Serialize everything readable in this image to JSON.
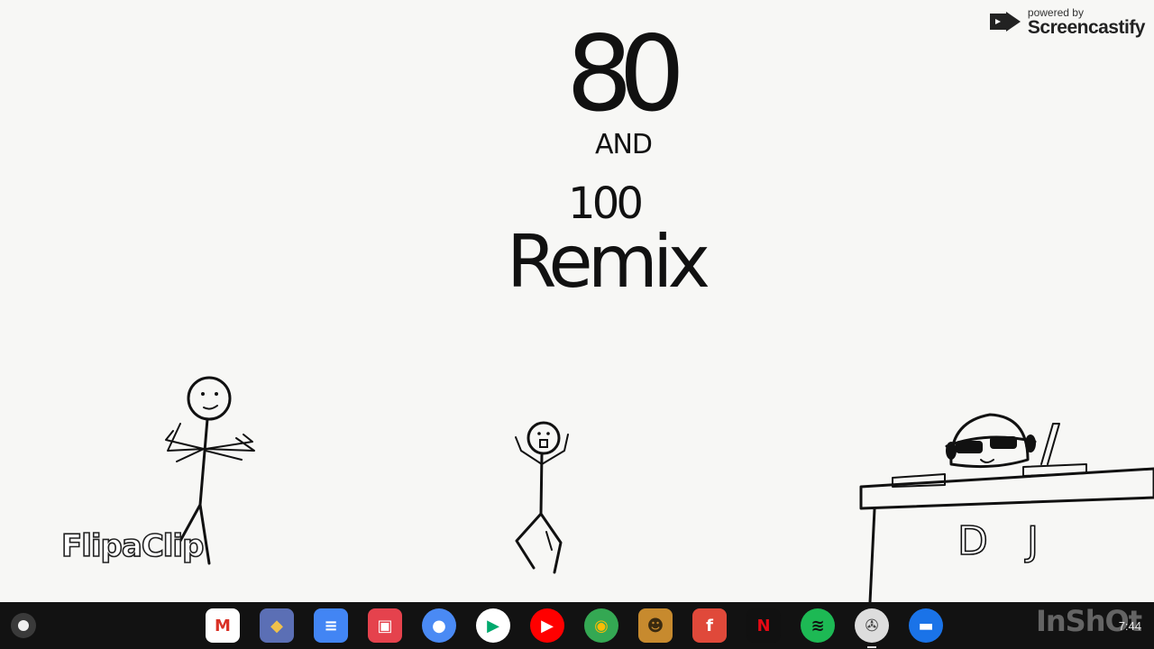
{
  "overlay": {
    "powered_by": "powered by",
    "brand": "Screencastify",
    "flipaclip": "FlipaClip",
    "inshot": "InShOt"
  },
  "drawing": {
    "title_line1": "80",
    "title_line2": "AND",
    "title_line3": "100",
    "title_line4": "Remix",
    "dj_label": "DJ"
  },
  "shelf": {
    "apps": [
      {
        "name": "gmail-icon",
        "color": "#ffffff",
        "glyph": "M",
        "fg": "#d93025"
      },
      {
        "name": "game-icon",
        "color": "#5b6fb5",
        "glyph": "◆",
        "fg": "#f0c14b"
      },
      {
        "name": "docs-icon",
        "color": "#4285f4",
        "glyph": "≡",
        "fg": "#ffffff"
      },
      {
        "name": "inshot-app-icon",
        "color": "#e5424d",
        "glyph": "▣",
        "fg": "#ffffff"
      },
      {
        "name": "palette-icon",
        "color": "#4a8af4",
        "glyph": "●",
        "fg": "#ffffff"
      },
      {
        "name": "play-store-icon",
        "color": "#ffffff",
        "glyph": "▶",
        "fg": "#00a96d"
      },
      {
        "name": "youtube-icon",
        "color": "#ff0000",
        "glyph": "▶",
        "fg": "#ffffff"
      },
      {
        "name": "chrome-icon",
        "color": "#34a853",
        "glyph": "◉",
        "fg": "#fbbc05"
      },
      {
        "name": "cartoon-game-icon",
        "color": "#c78a2e",
        "glyph": "☻",
        "fg": "#3a2a10"
      },
      {
        "name": "firetv-icon",
        "color": "#e0493a",
        "glyph": "f",
        "fg": "#ffffff"
      },
      {
        "name": "netflix-icon",
        "color": "#111111",
        "glyph": "N",
        "fg": "#e50914"
      },
      {
        "name": "spotify-icon",
        "color": "#1db954",
        "glyph": "≋",
        "fg": "#111111"
      },
      {
        "name": "settings-app-icon",
        "color": "#dddddd",
        "glyph": "✇",
        "fg": "#444444"
      },
      {
        "name": "files-icon",
        "color": "#1a73e8",
        "glyph": "▬",
        "fg": "#ffffff"
      }
    ],
    "time": "7:44"
  }
}
